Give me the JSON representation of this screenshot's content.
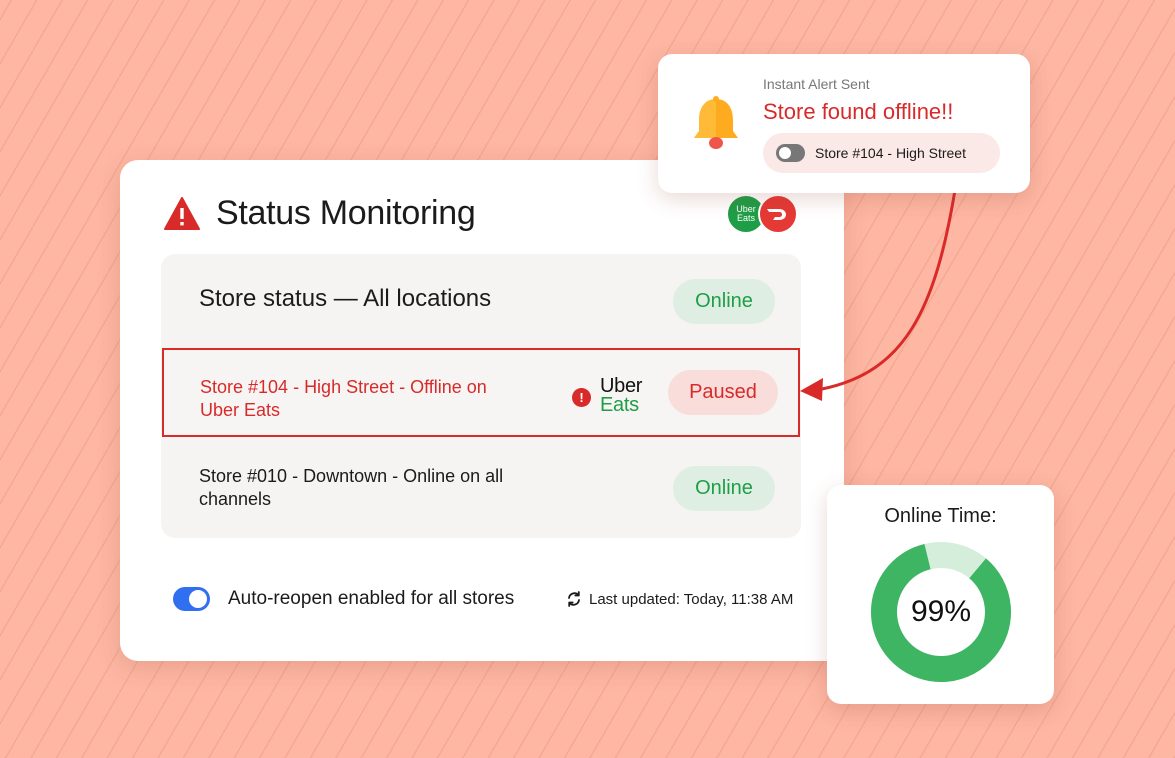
{
  "main": {
    "title": "Status Monitoring",
    "brand_icons": [
      "uber-eats-logo",
      "doordash-logo"
    ],
    "brand_badge_text": "Uber Eats",
    "rows": [
      {
        "label": "Store status — All locations",
        "status": "Online"
      },
      {
        "label": "Store #104 - High Street - Offline on Uber Eats",
        "status": "Paused",
        "channel_top": "Uber",
        "channel_bottom": "Eats",
        "error_mark": "!"
      },
      {
        "label": "Store #010 - Downtown - Online on all channels",
        "status": "Online"
      }
    ],
    "footer": {
      "auto_reopen_label": "Auto-reopen enabled for all stores",
      "auto_reopen_on": true,
      "last_updated": "Last updated: Today, 11:38 AM"
    }
  },
  "alert": {
    "subtitle": "Instant Alert Sent",
    "title": "Store found offline!!",
    "store_label": "Store #104 - High Street",
    "store_toggle_on": false
  },
  "online_time": {
    "title": "Online Time:",
    "value_label": "99%",
    "fraction": 0.85
  },
  "colors": {
    "background": "#fdb7a3",
    "alert_red": "#d92a2a",
    "online_green": "#1e9e47",
    "online_bg": "#dfeee2",
    "paused_bg": "#f8dddb",
    "toggle_blue": "#2f6ff0",
    "donut_green": "#3db562",
    "donut_track": "#d5eedb",
    "bell": "#ffab1f"
  }
}
